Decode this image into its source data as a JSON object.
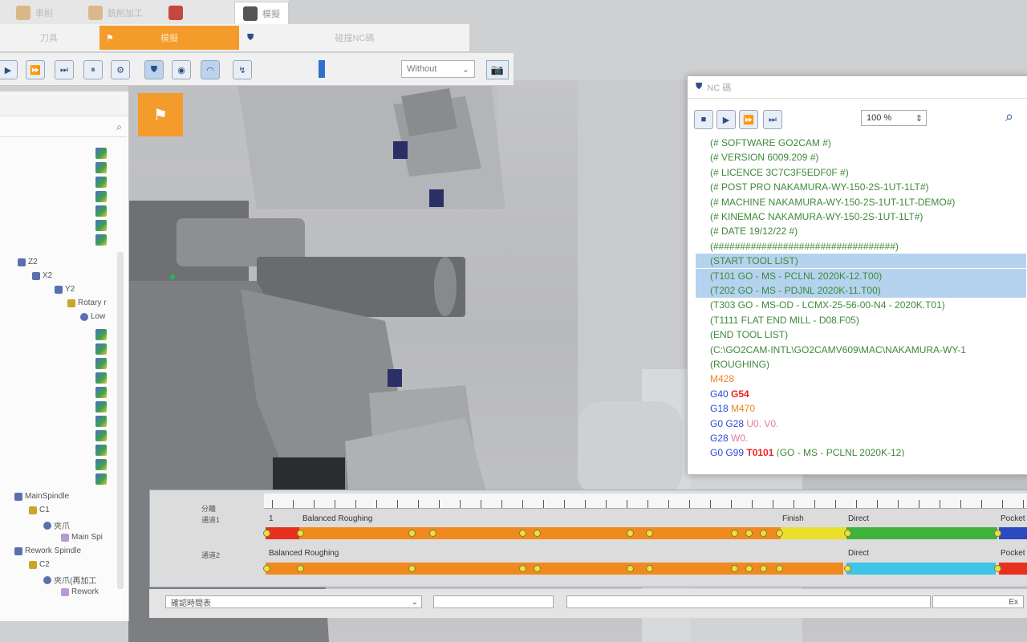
{
  "tabs": [
    {
      "label": "車削",
      "active": false
    },
    {
      "label": "銑削加工",
      "active": false
    },
    {
      "label": "",
      "active": false
    },
    {
      "label": "模擬",
      "active": true
    }
  ],
  "subtabs": [
    {
      "label": "刀具",
      "active": false
    },
    {
      "label": "模擬",
      "active": true
    },
    {
      "label": "碰撞NC碼",
      "active": false
    }
  ],
  "toolbar": {
    "view_mode": "Without",
    "view_mode_options": [
      "Without"
    ]
  },
  "tree": {
    "nodes": [
      {
        "label": "Z2",
        "depth": 1
      },
      {
        "label": "X2",
        "depth": 2
      },
      {
        "label": "Y2",
        "depth": 3
      },
      {
        "label": "Rotary r",
        "depth": 4
      },
      {
        "label": "Low",
        "depth": 5
      },
      {
        "label": "MainSpindle",
        "depth": 0
      },
      {
        "label": "C1",
        "depth": 1
      },
      {
        "label": "夾爪",
        "depth": 2
      },
      {
        "label": "Main Spi",
        "depth": 3
      },
      {
        "label": "Rework Spindle",
        "depth": 0
      },
      {
        "label": "C2",
        "depth": 1
      },
      {
        "label": "夾爪(再加工",
        "depth": 2
      },
      {
        "label": "Rework",
        "depth": 3
      }
    ]
  },
  "nc_window": {
    "title": "NC 碼",
    "zoom": "100 %",
    "lines": [
      {
        "text": "(# SOFTWARE GO2CAM               #)",
        "style": "green"
      },
      {
        "text": "(# VERSION  6009.209             #)",
        "style": "green"
      },
      {
        "text": "(# LICENCE  3C7C3F5EDF0F         #)",
        "style": "green"
      },
      {
        "text": "(# POST PRO NAKAMURA-WY-150-2S-1UT-1LT#)",
        "style": "green"
      },
      {
        "text": "(# MACHINE  NAKAMURA-WY-150-2S-1UT-1LT-DEMO#)",
        "style": "green"
      },
      {
        "text": "(# KINEMAC  NAKAMURA-WY-150-2S-1UT-1LT#)",
        "style": "green"
      },
      {
        "text": "(# DATE     19/12/22             #)",
        "style": "green"
      },
      {
        "text": "(##################################)",
        "style": "green"
      },
      {
        "text": "(START TOOL LIST)",
        "style": "green hl"
      },
      {
        "text": "(T101 GO - MS - PCLNL 2020K-12.T00)",
        "style": "green hl"
      },
      {
        "text": "(T202 GO - MS - PDJNL 2020K-11.T00)",
        "style": "green hl"
      },
      {
        "text": "(T303 GO - MS-OD - LCMX-25-56-00-N4 - 2020K.T01)",
        "style": "green"
      },
      {
        "text": "(T1111 FLAT END MILL - D08.F05)",
        "style": "green"
      },
      {
        "text": "(END TOOL LIST)",
        "style": "green"
      },
      {
        "text": "(C:\\GO2CAM-INTL\\GO2CAMV609\\MAC\\NAKAMURA-WY-1",
        "style": "green"
      },
      {
        "text": "(ROUGHING)",
        "style": "green"
      },
      {
        "text": "M428",
        "style": "orange"
      }
    ],
    "code_lines": [
      {
        "parts": [
          {
            "t": "G40 ",
            "s": "blue"
          },
          {
            "t": "G54",
            "s": "red"
          }
        ]
      },
      {
        "parts": [
          {
            "t": "G18 ",
            "s": "blue"
          },
          {
            "t": "M470",
            "s": "orange"
          }
        ]
      },
      {
        "parts": [
          {
            "t": "G0 G28 ",
            "s": "blue"
          },
          {
            "t": "U0. V0.",
            "s": "pink"
          }
        ]
      },
      {
        "parts": [
          {
            "t": "G28 ",
            "s": "blue"
          },
          {
            "t": "W0.",
            "s": "pink"
          }
        ]
      },
      {
        "parts": [
          {
            "t": "G0 G99 ",
            "s": "blue"
          },
          {
            "t": "T0101 ",
            "s": "red"
          },
          {
            "t": "(GO - MS - PCLNL 2020K-12)",
            "s": "green"
          }
        ]
      }
    ]
  },
  "timeline": {
    "header_label": "分離",
    "lane1_label": "通道1",
    "lane2_label": "通道2",
    "lane1_ops": [
      {
        "label": "1",
        "color": "#e8301e"
      },
      {
        "label": "Balanced Roughing",
        "color": "#f08a1e"
      },
      {
        "label": "Finish",
        "color": "#eadf2a"
      },
      {
        "label": "Direct",
        "color": "#3fb33a"
      },
      {
        "label": "Pocket",
        "color": "#2a48c0"
      }
    ],
    "lane2_ops": [
      {
        "label": "Balanced Roughing",
        "color": "#f08a1e"
      },
      {
        "label": "Direct",
        "color": "#3ec5e6"
      },
      {
        "label": "Pocket",
        "color": "#e8301e"
      }
    ]
  },
  "bottom": {
    "mode": "確認時間表",
    "right_btn": "Ex"
  }
}
